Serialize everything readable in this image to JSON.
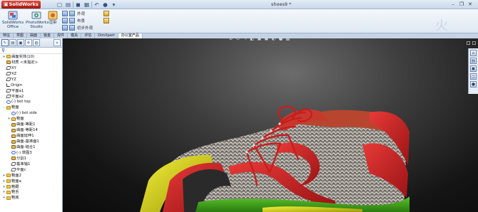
{
  "app": {
    "logo_text": "SolidWorks",
    "document_title": "shoes9 *"
  },
  "quick_access": [
    "new-icon",
    "open-icon",
    "save-icon",
    "print-icon",
    "undo-icon",
    "rebuild-icon",
    "options-icon"
  ],
  "ribbon": {
    "groups": [
      {
        "label": "SolidWorks Office",
        "icon": "solidworks-office-icon"
      },
      {
        "label": "PhotoWorks Studio",
        "icon": "photoworks-icon"
      },
      {
        "label": "渲染",
        "icon": "render-icon"
      }
    ],
    "menu_labels": [
      "外观",
      "布景",
      "初步外观"
    ]
  },
  "tabs": [
    "特征",
    "草图",
    "曲面",
    "钣金",
    "焊件",
    "模具",
    "评估",
    "DimXpert",
    "办公室产品"
  ],
  "active_tab_index": 8,
  "feature_manager": {
    "filter_icon": "filter-icon",
    "tree": [
      {
        "label": "曲面实体(10)",
        "level": 0,
        "icon": "folder",
        "twisty": "+"
      },
      {
        "label": "材质 <未指定>",
        "level": 0,
        "icon": "feat",
        "twisty": ""
      },
      {
        "label": "XY",
        "level": 0,
        "icon": "plane",
        "twisty": ""
      },
      {
        "label": "XZ",
        "level": 0,
        "icon": "plane",
        "twisty": ""
      },
      {
        "label": "YZ",
        "level": 0,
        "icon": "plane",
        "twisty": ""
      },
      {
        "label": "Origin",
        "level": 0,
        "icon": "origin",
        "twisty": ""
      },
      {
        "label": "平面a1",
        "level": 0,
        "icon": "plane",
        "twisty": ""
      },
      {
        "label": "平面a2",
        "level": 0,
        "icon": "plane",
        "twisty": ""
      },
      {
        "label": "(-) bot top",
        "level": 0,
        "icon": "sketch",
        "twisty": ""
      },
      {
        "label": "鞋面",
        "level": 0,
        "icon": "folder",
        "twisty": "-"
      },
      {
        "label": "(-) bot side",
        "level": 1,
        "icon": "sketch",
        "twisty": ""
      },
      {
        "label": "鞋面",
        "level": 1,
        "icon": "part",
        "twisty": "+"
      },
      {
        "label": "曲面-等距1",
        "level": 1,
        "icon": "feat",
        "twisty": ""
      },
      {
        "label": "曲面-等距14",
        "level": 1,
        "icon": "feat",
        "twisty": ""
      },
      {
        "label": "曲面延伸1",
        "level": 1,
        "icon": "feat",
        "twisty": ""
      },
      {
        "label": "曲面-基准面1",
        "level": 1,
        "icon": "feat",
        "twisty": ""
      },
      {
        "label": "曲面-缝合1",
        "level": 1,
        "icon": "feat",
        "twisty": ""
      },
      {
        "label": "(-) 草图3",
        "level": 1,
        "icon": "sketch",
        "twisty": ""
      },
      {
        "label": "分割1",
        "level": 1,
        "icon": "feat",
        "twisty": ""
      },
      {
        "label": "基准轴1",
        "level": 1,
        "icon": "plane",
        "twisty": ""
      },
      {
        "label": "平面c",
        "level": 1,
        "icon": "plane",
        "twisty": ""
      },
      {
        "label": "鞋面2",
        "level": 0,
        "icon": "folder",
        "twisty": "+"
      },
      {
        "label": "鞋面a",
        "level": 0,
        "icon": "folder",
        "twisty": "+"
      },
      {
        "label": "鞋跟",
        "level": 0,
        "icon": "folder",
        "twisty": "+"
      },
      {
        "label": "鞋舌",
        "level": 0,
        "icon": "folder",
        "twisty": "+"
      },
      {
        "label": "鞋底",
        "level": 0,
        "icon": "folder",
        "twisty": "+"
      }
    ]
  },
  "heads_up_toolbar": [
    "zoom-fit-icon",
    "zoom-area-icon",
    "previous-view-icon",
    "section-view-icon",
    "view-orientation-icon",
    "display-style-icon",
    "hide-show-icon",
    "appearance-icon",
    "scene-icon"
  ],
  "task_pane": [
    "resources-icon",
    "design-library-icon",
    "file-explorer-icon",
    "view-palette-icon",
    "appearances-icon"
  ]
}
